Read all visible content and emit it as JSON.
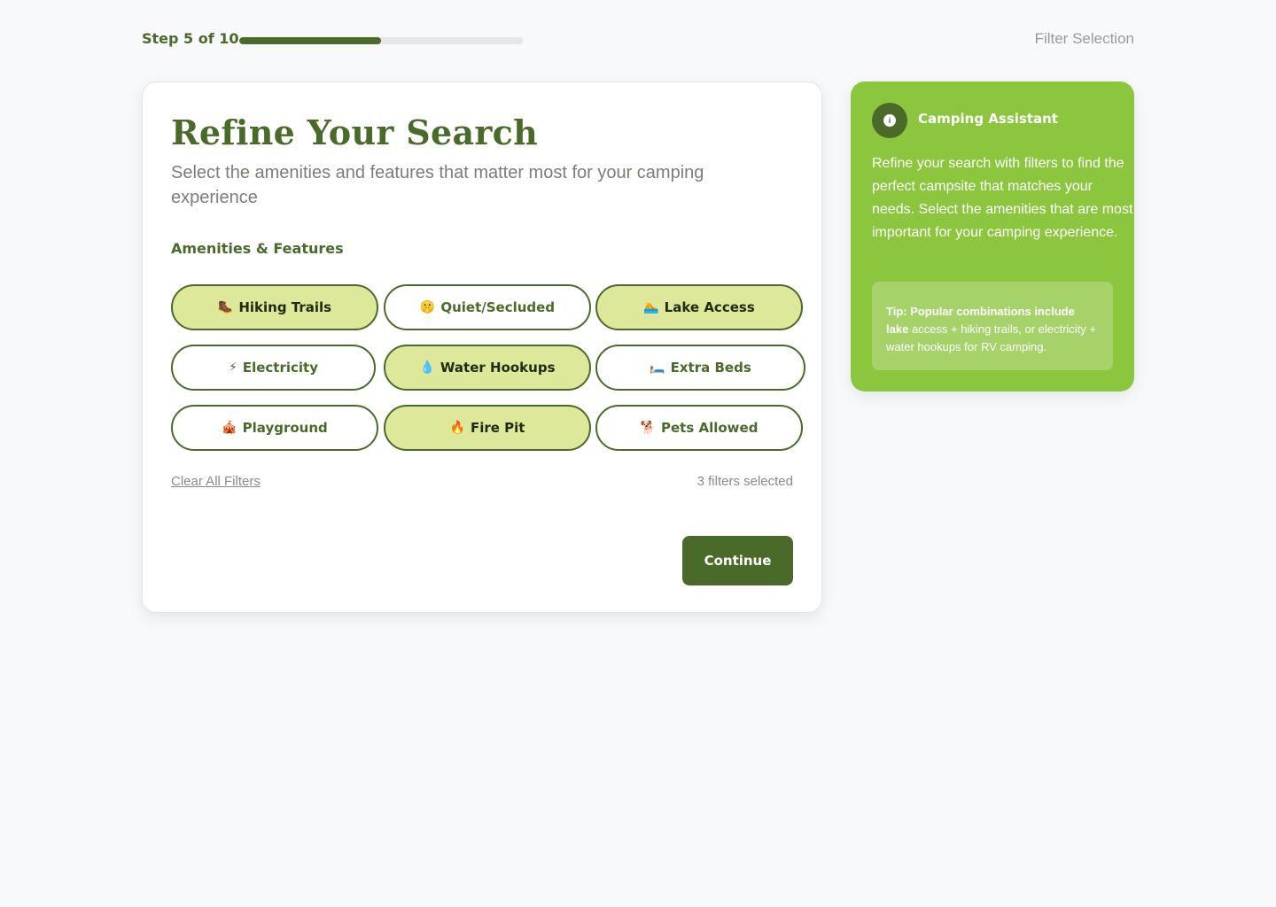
{
  "progress": {
    "step_label": "Step 5 of 10",
    "current_step": 5,
    "total_steps": 10,
    "fraction": 0.5,
    "page_label": "Filter Selection"
  },
  "main": {
    "title": "Refine Your Search",
    "subtitle": "Select the amenities and features that matter most for your camping experience",
    "section_label": "Amenities & Features",
    "chips": [
      {
        "emoji": "🥾",
        "label": "Hiking Trails",
        "selected": true
      },
      {
        "emoji": "🤫",
        "label": "Quiet/Secluded",
        "selected": false
      },
      {
        "emoji": "🏊",
        "label": "Lake Access",
        "selected": true
      },
      {
        "emoji": "⚡",
        "label": "Electricity",
        "selected": false
      },
      {
        "emoji": "💧",
        "label": "Water Hookups",
        "selected": true
      },
      {
        "emoji": "🛏️",
        "label": "Extra Beds",
        "selected": false
      },
      {
        "emoji": "🎪",
        "label": "Playground",
        "selected": false
      },
      {
        "emoji": "🔥",
        "label": "Fire Pit",
        "selected": true
      },
      {
        "emoji": "🐕",
        "label": "Pets Allowed",
        "selected": false
      }
    ],
    "clear_label": "Clear All Filters",
    "count_label": "3 filters selected",
    "continue_label": "Continue"
  },
  "assistant": {
    "title": "Camping Assistant",
    "avatar_icon": "info-icon",
    "body": "Refine your search with filters to find the perfect campsite that matches your needs. Select the amenities that are most important for your camping experience.",
    "tip_bold": "Tip: Popular combinations include lake",
    "tip_rest": "access + hiking trails, or electricity + water hookups for RV camping."
  },
  "colors": {
    "brand": "#4a6a2a",
    "accent": "#8cc63f",
    "selected_chip": "#dde89a"
  }
}
